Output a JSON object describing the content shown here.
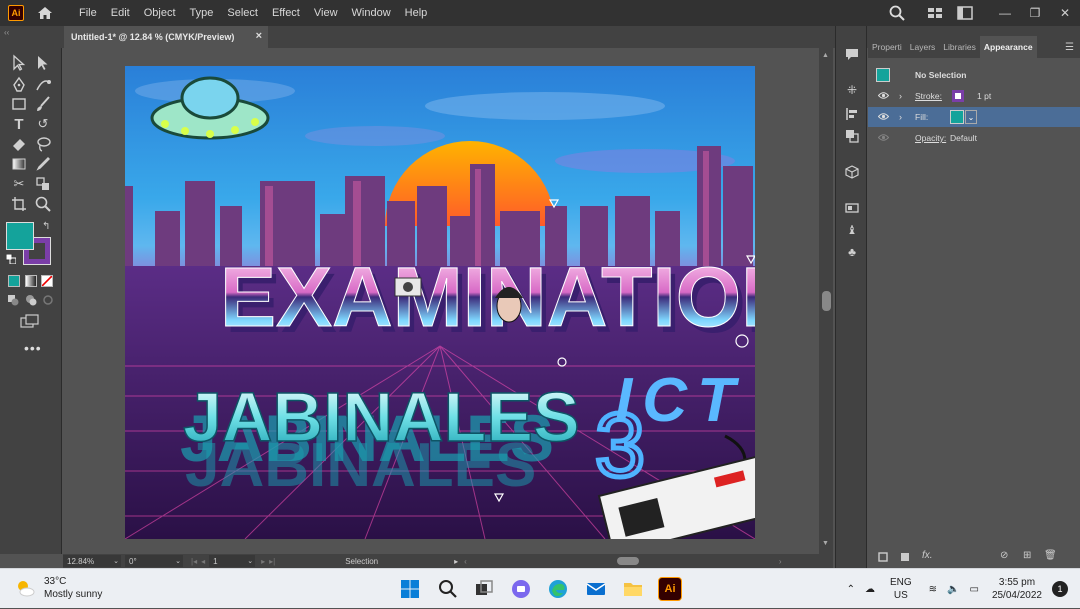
{
  "app": {
    "logo_text": "Ai",
    "menu": [
      "File",
      "Edit",
      "Object",
      "Type",
      "Select",
      "Effect",
      "View",
      "Window",
      "Help"
    ]
  },
  "document": {
    "tab_title": "Untitled-1* @ 12.84 % (CMYK/Preview)",
    "close_glyph": "×"
  },
  "artwork": {
    "word1": "EXAMINATION",
    "word2": "JABINALES",
    "word3": "ICT",
    "number": "3"
  },
  "statusbar": {
    "zoom": "12.84%",
    "rotation": "0°",
    "artboard_number": "1",
    "tool": "Selection"
  },
  "panel": {
    "tabs": [
      "Properti",
      "Layers",
      "Libraries",
      "Appearance"
    ],
    "active_tab": "Appearance",
    "no_selection": "No Selection",
    "stroke_label": "Stroke:",
    "stroke_value": "1 pt",
    "fill_label": "Fill:",
    "opacity_label": "Opacity:",
    "opacity_value": "Default",
    "fx_label": "fx."
  },
  "colors": {
    "fill": "#14a39b",
    "stroke": "#7a3ea8",
    "selection_row": "#4b6d97"
  },
  "taskbar": {
    "temperature": "33°C",
    "weather": "Mostly sunny",
    "lang_top": "ENG",
    "lang_bottom": "US",
    "time": "3:55 pm",
    "date": "25/04/2022",
    "notification_count": "1",
    "ai_app_label": "Ai"
  }
}
